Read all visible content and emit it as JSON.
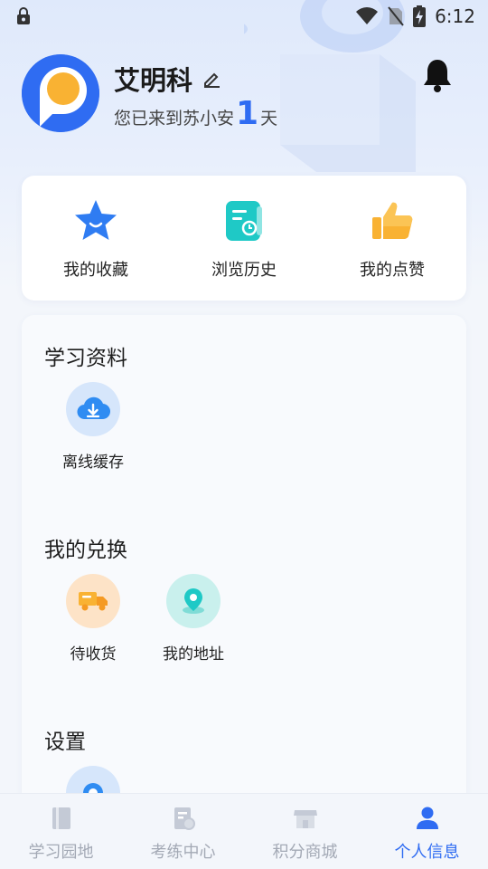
{
  "status_bar": {
    "time": "6:12",
    "icons": [
      "lock-icon",
      "wifi-icon",
      "no-sim-icon",
      "battery-charging-icon"
    ]
  },
  "profile": {
    "name": "艾明科",
    "welcome_prefix": "您已来到苏小安",
    "days": "1",
    "welcome_suffix": "天",
    "icons": [
      "edit-icon",
      "bell-icon"
    ]
  },
  "quick_actions": [
    {
      "label": "我的收藏",
      "icon": "star-icon"
    },
    {
      "label": "浏览历史",
      "icon": "history-icon"
    },
    {
      "label": "我的点赞",
      "icon": "thumbs-up-icon"
    }
  ],
  "sections": [
    {
      "title": "学习资料",
      "items": [
        {
          "label": "离线缓存",
          "icon": "cloud-download-icon"
        }
      ]
    },
    {
      "title": "我的兑换",
      "items": [
        {
          "label": "待收货",
          "icon": "truck-icon"
        },
        {
          "label": "我的地址",
          "icon": "location-pin-icon"
        }
      ]
    },
    {
      "title": "设置",
      "items": [
        {
          "label": "",
          "icon": "settings-icon"
        }
      ]
    }
  ],
  "bottom_nav": [
    {
      "label": "学习园地",
      "icon": "book-icon",
      "active": false
    },
    {
      "label": "考练中心",
      "icon": "exam-icon",
      "active": false
    },
    {
      "label": "积分商城",
      "icon": "store-icon",
      "active": false
    },
    {
      "label": "个人信息",
      "icon": "person-icon",
      "active": true
    }
  ],
  "colors": {
    "accent": "#2f6cf2",
    "inactive_nav": "#a3a9b5",
    "star": "#2f7cf2",
    "history": "#1fc9c6",
    "thumb": "#f9b233"
  }
}
